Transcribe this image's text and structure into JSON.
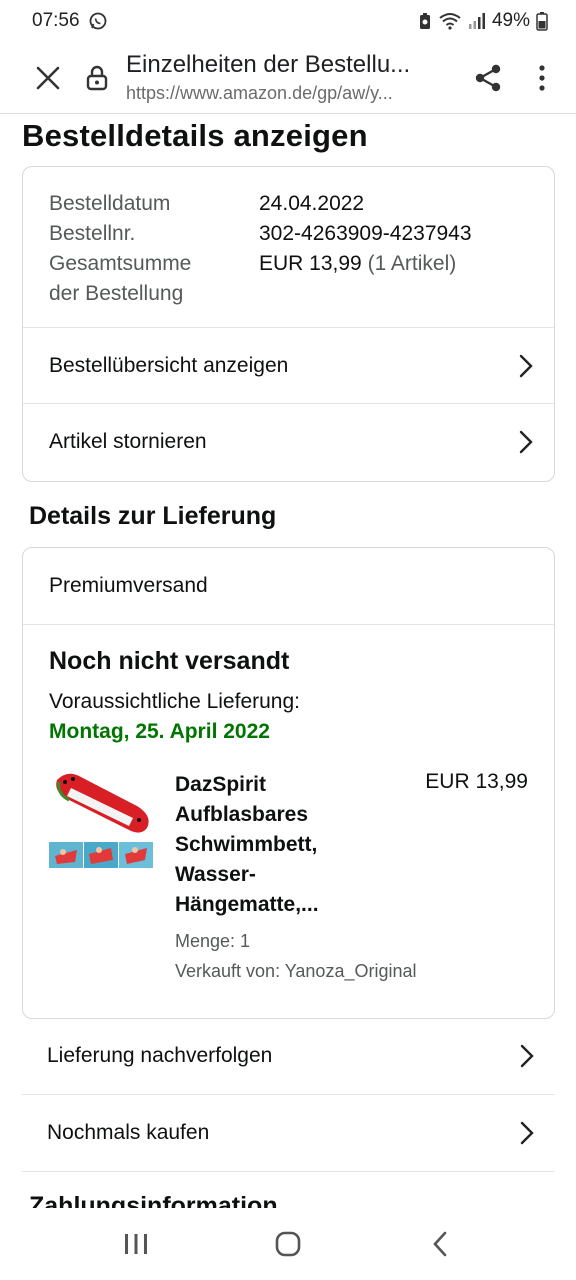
{
  "status_bar": {
    "time": "07:56",
    "battery": "49%"
  },
  "browser": {
    "title": "Einzelheiten der Bestellu...",
    "url": "https://www.amazon.de/gp/aw/y..."
  },
  "page": {
    "title": "Bestelldetails anzeigen"
  },
  "order": {
    "date_label": "Bestelldatum",
    "date_value": "24.04.2022",
    "number_label": "Bestellnr.",
    "number_value": "302-4263909-4237943",
    "total_label_1": "Gesamtsumme",
    "total_label_2": "der Bestellung",
    "total_value": "EUR 13,99",
    "total_count": "(1 Artikel)",
    "links": [
      {
        "label": "Bestellübersicht anzeigen"
      },
      {
        "label": "Artikel stornieren"
      }
    ]
  },
  "delivery": {
    "section_title": "Details zur Lieferung",
    "shipping_type": "Premiumversand",
    "status": "Noch nicht versandt",
    "estimate_label": "Voraussichtliche Lieferung:",
    "estimate_date": "Montag, 25. April 2022",
    "item": {
      "title": "DazSpirit Aufblasbares Schwimmbett, Wasser-Hängematte,...",
      "price": "EUR 13,99",
      "quantity": "Menge: 1",
      "seller": "Verkauft von: Yanoza_Original"
    }
  },
  "actions": [
    {
      "label": "Lieferung nachverfolgen"
    },
    {
      "label": "Nochmals kaufen"
    }
  ],
  "partial_section_title": "Zahlungsinformation",
  "colors": {
    "green_date": "#007600",
    "text": "#0f1111",
    "muted": "#565959"
  }
}
